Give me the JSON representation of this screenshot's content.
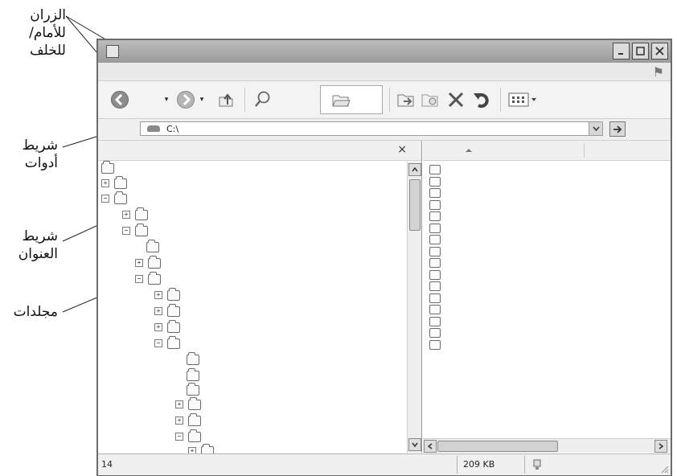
{
  "callouts": {
    "nav_buttons": [
      "الزران",
      "للأمام/",
      "للخلف"
    ],
    "toolbar": [
      "شريط",
      "أدوات"
    ],
    "addressbar": [
      "شريط",
      "العنوان"
    ],
    "folders": "مجلدات"
  },
  "window": {
    "title": "",
    "controls": [
      "minimize-icon",
      "maximize-icon",
      "close-icon"
    ]
  },
  "toolbar": {
    "buttons": [
      "back-icon",
      "forward-icon",
      "up-folder-icon",
      "search-icon",
      "folders-icon",
      "move-to-icon",
      "copy-to-icon",
      "delete-icon",
      "undo-icon",
      "views-icon"
    ]
  },
  "address": {
    "value": "C:\\"
  },
  "left_pane": {
    "close_label": "×",
    "tree_icons": [
      "desktop-icon",
      "my-documents-icon",
      "my-computer-icon",
      "floppy-drive-icon",
      "local-disk-icon",
      "folder-icon",
      "folder-icon",
      "folder-icon",
      "folder-icon",
      "folder-icon",
      "folder-icon",
      "folder-icon",
      "folder-icon",
      "folder-icon",
      "folder-icon",
      "favorites-icon",
      "folder-icon",
      "folder-icon",
      "control-panel-icon"
    ]
  },
  "right_pane": {
    "items": [
      "folder-icon",
      "folder-icon",
      "folder-icon",
      "folder-icon",
      "folder-icon",
      "folder-icon",
      "folder-icon",
      "folder-icon",
      "folder-icon",
      "folder-icon",
      "folder-icon",
      "folder-icon",
      "folder-icon",
      "folder-icon",
      "text-file-icon",
      "system-file-icon"
    ]
  },
  "status": {
    "left": "14",
    "size": "209 KB"
  },
  "colors": {
    "titlebar": "#aaaaaa",
    "toolbar": "#f3f3f3",
    "frame": "#6b6b6b"
  }
}
